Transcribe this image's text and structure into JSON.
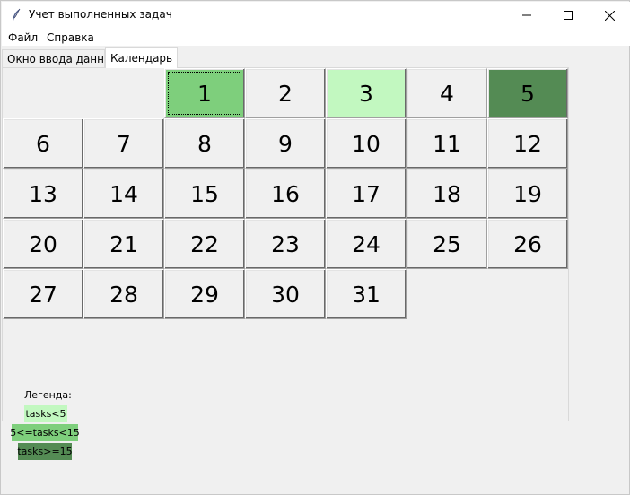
{
  "window": {
    "title": "Учет выполненных задач",
    "icon": "feather-icon"
  },
  "menu": {
    "file": "Файл",
    "help": "Справка"
  },
  "tabs": [
    {
      "label": "Окно ввода данных",
      "selected": false
    },
    {
      "label": "Календарь",
      "selected": true
    }
  ],
  "calendar": {
    "days": [
      {
        "label": "1",
        "level": "mid"
      },
      {
        "label": "2",
        "level": "none"
      },
      {
        "label": "3",
        "level": "low"
      },
      {
        "label": "4",
        "level": "none"
      },
      {
        "label": "5",
        "level": "high"
      },
      {
        "label": "6",
        "level": "none"
      },
      {
        "label": "7",
        "level": "none"
      },
      {
        "label": "8",
        "level": "none"
      },
      {
        "label": "9",
        "level": "none"
      },
      {
        "label": "10",
        "level": "none"
      },
      {
        "label": "11",
        "level": "none"
      },
      {
        "label": "12",
        "level": "none"
      },
      {
        "label": "13",
        "level": "none"
      },
      {
        "label": "14",
        "level": "none"
      },
      {
        "label": "15",
        "level": "none"
      },
      {
        "label": "16",
        "level": "none"
      },
      {
        "label": "17",
        "level": "none"
      },
      {
        "label": "18",
        "level": "none"
      },
      {
        "label": "19",
        "level": "none"
      },
      {
        "label": "20",
        "level": "none"
      },
      {
        "label": "21",
        "level": "none"
      },
      {
        "label": "22",
        "level": "none"
      },
      {
        "label": "23",
        "level": "none"
      },
      {
        "label": "24",
        "level": "none"
      },
      {
        "label": "25",
        "level": "none"
      },
      {
        "label": "26",
        "level": "none"
      },
      {
        "label": "27",
        "level": "none"
      },
      {
        "label": "28",
        "level": "none"
      },
      {
        "label": "29",
        "level": "none"
      },
      {
        "label": "30",
        "level": "none"
      },
      {
        "label": "31",
        "level": "none"
      }
    ],
    "first_weekday_index": 2,
    "focused_day": "1"
  },
  "legend": {
    "title": "Легенда:",
    "items": [
      {
        "label": "tasks<5",
        "level": "low"
      },
      {
        "label": "5<=tasks<15",
        "level": "mid"
      },
      {
        "label": "tasks>=15",
        "level": "high"
      }
    ]
  },
  "colors": {
    "low": "#c2f8c0",
    "mid": "#7ecf7c",
    "high": "#548b54",
    "none": "#f0f0f0"
  }
}
